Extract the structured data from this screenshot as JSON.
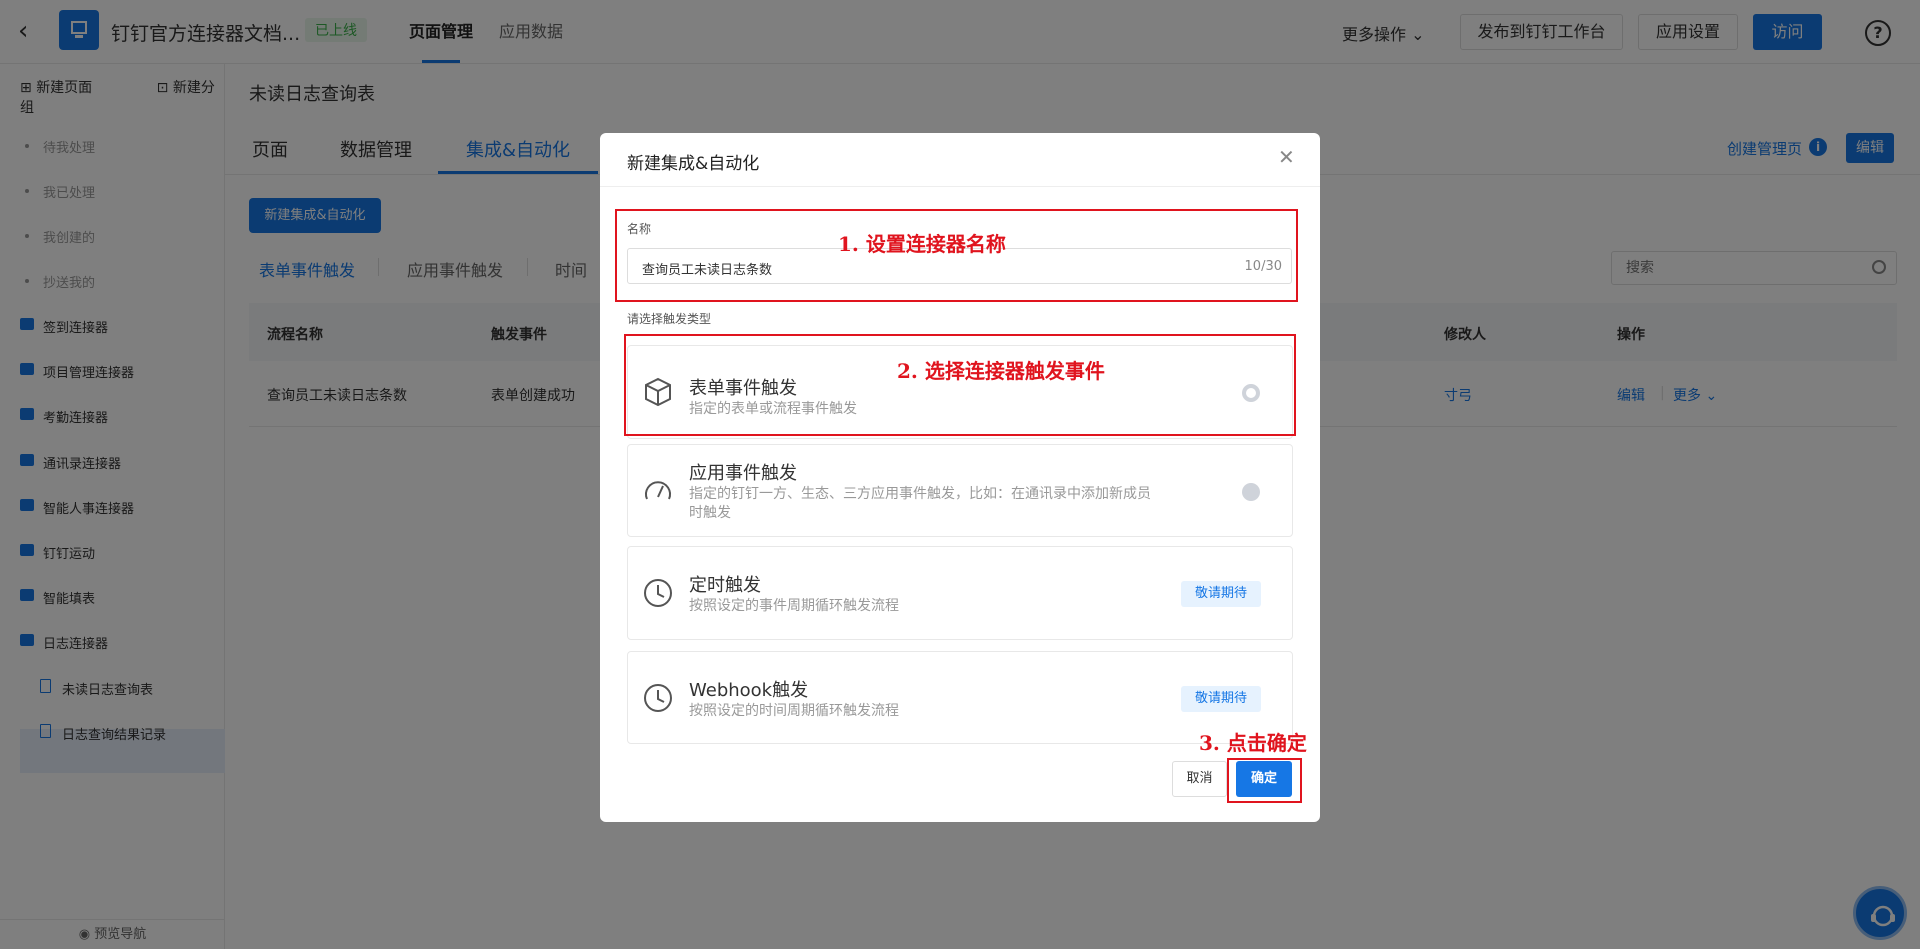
{
  "topbar": {
    "app_title": "钉钉官方连接器文档...",
    "status_badge": "已上线",
    "tabs": [
      "页面管理",
      "应用数据"
    ],
    "more_ops": "更多操作",
    "publish": "发布到钉钉工作台",
    "settings": "应用设置",
    "visit": "访问",
    "help": "?"
  },
  "sidebar": {
    "new_page": "新建页面",
    "new_group": "新建分组",
    "items": [
      {
        "label": "待我处理",
        "kind": "dot"
      },
      {
        "label": "我已处理",
        "kind": "dot"
      },
      {
        "label": "我创建的",
        "kind": "dot"
      },
      {
        "label": "抄送我的",
        "kind": "dot"
      },
      {
        "label": "签到连接器",
        "kind": "folder"
      },
      {
        "label": "项目管理连接器",
        "kind": "folder"
      },
      {
        "label": "考勤连接器",
        "kind": "folder"
      },
      {
        "label": "通讯录连接器",
        "kind": "folder"
      },
      {
        "label": "智能人事连接器",
        "kind": "folder"
      },
      {
        "label": "钉钉运动",
        "kind": "folder"
      },
      {
        "label": "智能填表",
        "kind": "folder"
      },
      {
        "label": "日志连接器",
        "kind": "folder"
      },
      {
        "label": "未读日志查询表",
        "kind": "doc"
      },
      {
        "label": "日志查询结果记录",
        "kind": "doc"
      }
    ],
    "preview_nav": "预览导航"
  },
  "main": {
    "title": "未读日志查询表",
    "tabs": [
      "页面",
      "数据管理",
      "集成&自动化"
    ],
    "create_manage": "创建管理页",
    "edit": "编辑",
    "new_button": "新建集成&自动化",
    "sub_tabs": [
      "表单事件触发",
      "应用事件触发",
      "时间"
    ],
    "search_placeholder": "搜索",
    "table_headers": [
      "流程名称",
      "触发事件",
      "修改人",
      "操作"
    ],
    "row": {
      "name": "查询员工未读日志条数",
      "event": "表单创建成功",
      "modifier": "寸弓",
      "edit": "编辑",
      "more": "更多"
    }
  },
  "modal": {
    "title": "新建集成&自动化",
    "name_label": "名称",
    "name_value": "查询员工未读日志条数",
    "name_count": "10/30",
    "trigger_label": "请选择触发类型",
    "cards": [
      {
        "title": "表单事件触发",
        "desc": "指定的表单或流程事件触发",
        "icon": "cube-icon"
      },
      {
        "title": "应用事件触发",
        "desc": "指定的钉钉一方、生态、三方应用事件触发，比如：在通讯录中添加新成员时触发",
        "icon": "gauge-icon"
      },
      {
        "title": "定时触发",
        "desc": "按照设定的事件周期循环触发流程",
        "icon": "clock-icon",
        "badge": "敬请期待"
      },
      {
        "title": "Webhook触发",
        "desc": "按照设定的时间周期循环触发流程",
        "icon": "clock-icon",
        "badge": "敬请期待"
      }
    ],
    "cancel": "取消",
    "ok": "确定"
  },
  "annotations": {
    "step1": "1. 设置连接器名称",
    "step2": "2. 选择连接器触发事件",
    "step3": "3. 点击确定"
  },
  "colors": {
    "primary": "#1677e5",
    "annotation": "#e0141e",
    "online": "#3bb14a"
  }
}
